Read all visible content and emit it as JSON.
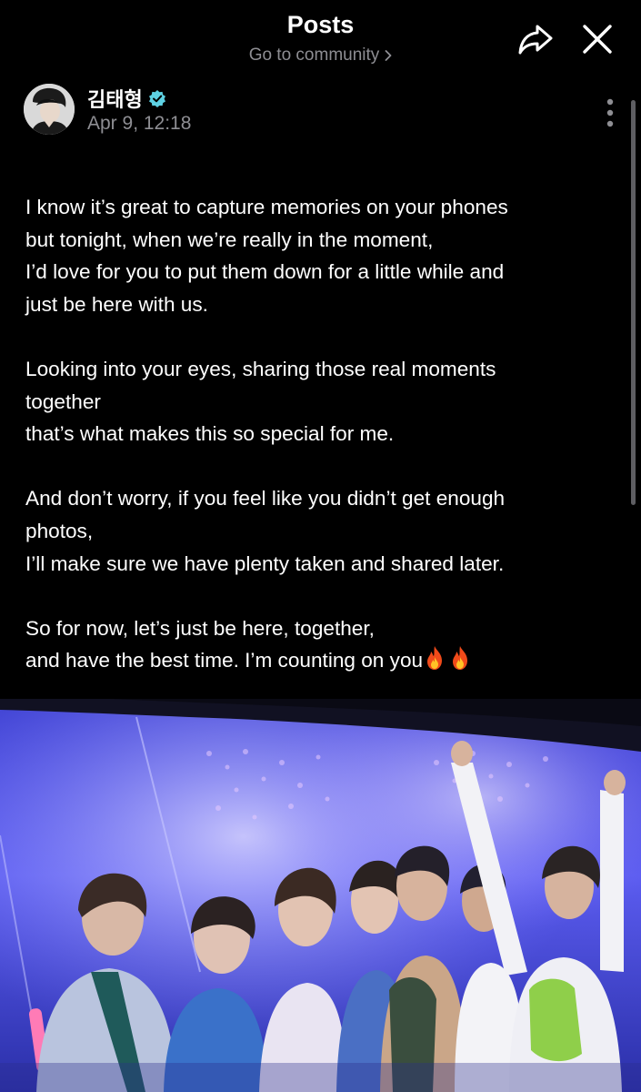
{
  "header": {
    "title": "Posts",
    "community_link": "Go to community"
  },
  "author": {
    "name": "김태형",
    "verified": true,
    "timestamp": "Apr 9, 12:18"
  },
  "post": {
    "paragraphs": [
      {
        "lines": [
          "I know it’s great to capture memories on your phones",
          "but tonight, when we’re really in the moment,",
          "I’d love for you to put them down for a little while and",
          "just be here with us."
        ]
      },
      {
        "lines": [
          "Looking into your eyes, sharing those real moments",
          "together",
          "that’s what makes this so special for me."
        ]
      },
      {
        "lines": [
          "And don’t worry, if you feel like you didn’t get enough",
          "photos,",
          "I’ll make sure we have plenty taken and shared later."
        ]
      },
      {
        "lines": [
          "So for now, let’s just be here, together,",
          "and have the best time. I’m counting on you"
        ]
      }
    ],
    "trailing_emoji": [
      "fire-icon",
      "fire-icon"
    ]
  },
  "colors": {
    "background": "#000000",
    "text": "#ffffff",
    "secondary_text": "#8e8e93",
    "verified_badge": "#5ed1e3",
    "stage_light": "#6e6ef5"
  },
  "icons": [
    "share-icon",
    "close-icon",
    "chevron-right-icon",
    "verified-icon",
    "more-vertical-icon",
    "fire-icon"
  ]
}
